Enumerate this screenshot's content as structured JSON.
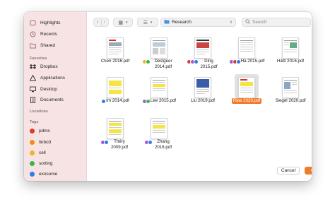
{
  "sidebar": {
    "favorites_section": [
      {
        "label": "Highlights",
        "icon": "highlights-icon"
      },
      {
        "label": "Recents",
        "icon": "clock-icon"
      },
      {
        "label": "Shared",
        "icon": "shared-folder-icon"
      }
    ],
    "favorites_title": "Favorites",
    "favorites": [
      {
        "label": "Dropbox",
        "icon": "dropbox-icon"
      },
      {
        "label": "Applications",
        "icon": "applications-icon"
      },
      {
        "label": "Desktop",
        "icon": "desktop-icon"
      },
      {
        "label": "Documents",
        "icon": "documents-icon"
      }
    ],
    "locations_title": "Locations",
    "tags_title": "Tags",
    "tags": [
      {
        "label": "pdms",
        "color": "#e0392f"
      },
      {
        "label": "linbo3",
        "color": "#f28b1e"
      },
      {
        "label": "cell",
        "color": "#f0b323"
      },
      {
        "label": "sorting",
        "color": "#34b846"
      },
      {
        "label": "exosome",
        "color": "#2f7de8"
      }
    ]
  },
  "toolbar": {
    "back": "‹",
    "forward": "›",
    "view_icons": "▦",
    "view_list": "☰",
    "path": "Research",
    "search_placeholder": "Search"
  },
  "files": [
    {
      "name": "Chen 2016.pdf",
      "tags": [],
      "selected": false
    },
    {
      "name": "Destgeer 2014.pdf",
      "tags": [
        "#f0b323",
        "#34b846"
      ],
      "selected": false
    },
    {
      "name": "Ding 2015.pdf",
      "tags": [
        "#e0392f",
        "#a855d8",
        "#2f7de8"
      ],
      "selected": false
    },
    {
      "name": "Ha 2015.pdf",
      "tags": [
        "#a855d8",
        "#e0392f",
        "#2f7de8"
      ],
      "selected": false
    },
    {
      "name": "Hälti 2016.pdf",
      "tags": [],
      "selected": false
    },
    {
      "name": "Im 2014.pdf",
      "tags": [
        "#2f7de8"
      ],
      "selected": false
    },
    {
      "name": "Lee 2015.pdf",
      "tags": [
        "#a855d8",
        "#34b846"
      ],
      "selected": false
    },
    {
      "name": "Liu 2019.pdf",
      "tags": [],
      "selected": false
    },
    {
      "name": "Ribe 2020.pdf",
      "tags": [],
      "selected": true
    },
    {
      "name": "Siegel 2020.pdf",
      "tags": [],
      "selected": false
    },
    {
      "name": "Théry 2009.pdf",
      "tags": [
        "#a855d8",
        "#2f7de8"
      ],
      "selected": false
    },
    {
      "name": "Zhang 2016.pdf",
      "tags": [
        "#a855d8",
        "#2f7de8"
      ],
      "selected": false
    }
  ],
  "footer": {
    "cancel": "Cancel",
    "open": "Open"
  },
  "colors": {
    "accent": "#f07c2a",
    "sidebar_bg": "#f7e3e3"
  }
}
